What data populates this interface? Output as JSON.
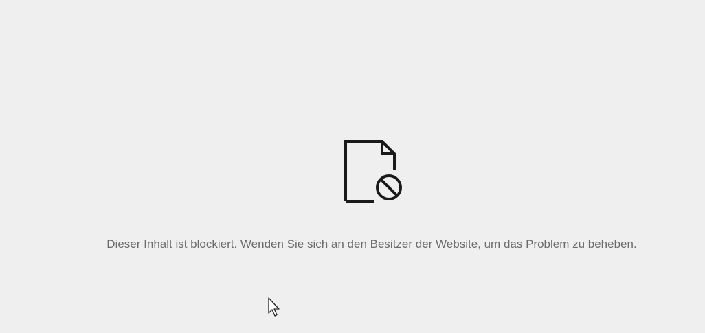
{
  "error_page": {
    "icon": "document-blocked-icon",
    "message": "Dieser Inhalt ist blockiert. Wenden Sie sich an den Besitzer der Website, um das Problem zu beheben."
  },
  "cursor": {
    "icon": "mouse-pointer-icon"
  },
  "colors": {
    "background": "#efefef",
    "icon": "#1a1a1a",
    "text": "#6b6b6b"
  }
}
